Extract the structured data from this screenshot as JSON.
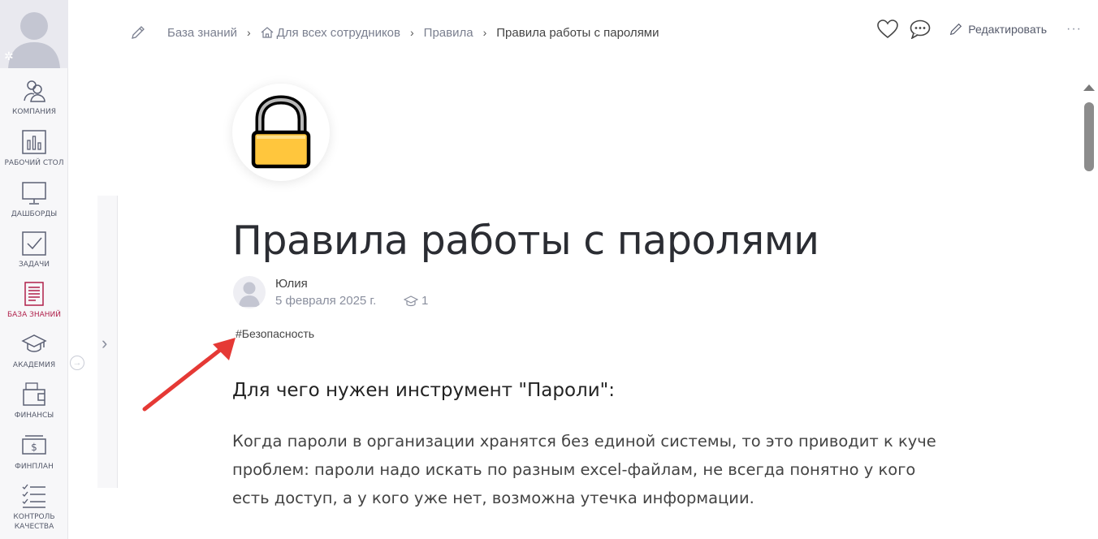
{
  "sidebar": {
    "items": [
      {
        "label": "КОМПАНИЯ",
        "icon": "people-icon"
      },
      {
        "label": "РАБОЧИЙ СТОЛ",
        "icon": "bar-chart-icon"
      },
      {
        "label": "ДАШБОРДЫ",
        "icon": "monitor-icon"
      },
      {
        "label": "ЗАДАЧИ",
        "icon": "checkbox-icon"
      },
      {
        "label": "БАЗА ЗНАНИЙ",
        "icon": "document-icon",
        "active": true
      },
      {
        "label": "АКАДЕМИЯ",
        "icon": "graduation-cap-icon"
      },
      {
        "label": "ФИНАНСЫ",
        "icon": "wallet-icon"
      },
      {
        "label": "ФИНПЛАН",
        "icon": "money-plan-icon"
      },
      {
        "label": "КОНТРОЛЬ КАЧЕСТВА",
        "icon": "checklist-icon"
      }
    ]
  },
  "breadcrumb": {
    "items": [
      "База знаний",
      "Для всех сотрудников",
      "Правила"
    ],
    "current": "Правила работы с паролями",
    "separator": "›"
  },
  "header": {
    "edit_label": "Редактировать",
    "more_label": "···"
  },
  "article": {
    "title": "Правила работы с паролями",
    "author": "Юлия",
    "date": "5 февраля 2025 г.",
    "views": "1",
    "tag": "#Безопасность",
    "section_heading": "Для чего нужен инструмент \"Пароли\":",
    "paragraph": "Когда пароли в организации хранятся без единой системы, то это приводит к куче проблем: пароли надо искать по разным excel-файлам, не всегда понятно у кого есть доступ, а у кого уже нет, возможна утечка информации."
  },
  "colors": {
    "accent": "#b0204b",
    "lock_body": "#ffc63d",
    "annotation_arrow": "#e53935"
  }
}
